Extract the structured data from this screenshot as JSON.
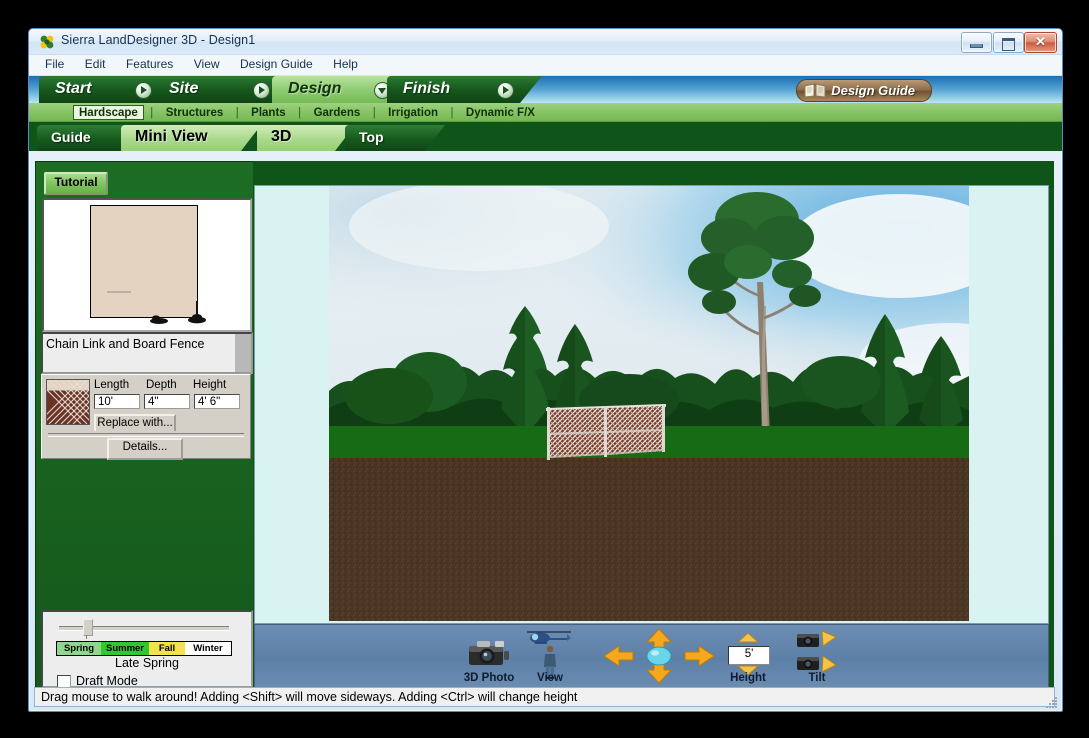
{
  "window": {
    "title": "Sierra LandDesigner 3D - Design1",
    "app_icon": "clover-icon",
    "minimize_label": "",
    "maximize_label": "",
    "close_label": "✕"
  },
  "menubar": {
    "items": [
      {
        "label": "File"
      },
      {
        "label": "Edit"
      },
      {
        "label": "Features"
      },
      {
        "label": "View"
      },
      {
        "label": "Design Guide"
      },
      {
        "label": "Help"
      }
    ]
  },
  "banner": {
    "stages": [
      {
        "label": "Start",
        "state": "dark",
        "arrow": "play"
      },
      {
        "label": "Site",
        "state": "dark",
        "arrow": "play"
      },
      {
        "label": "Design",
        "state": "light",
        "arrow": "down"
      },
      {
        "label": "Finish",
        "state": "dark",
        "arrow": "play"
      }
    ],
    "design_guide_label": "Design Guide",
    "design_guide_icon": "book-icon"
  },
  "subnav": {
    "items": [
      {
        "label": "Hardscape",
        "active": true
      },
      {
        "label": "Structures",
        "active": false
      },
      {
        "label": "Plants",
        "active": false
      },
      {
        "label": "Gardens",
        "active": false
      },
      {
        "label": "Irrigation",
        "active": false
      },
      {
        "label": "Dynamic F/X",
        "active": false
      }
    ],
    "separator": "|"
  },
  "tabs": {
    "left": [
      {
        "label": "Guide",
        "state": "dark"
      },
      {
        "label": "Mini View",
        "state": "light"
      }
    ],
    "right": [
      {
        "label": "3D",
        "state": "light"
      },
      {
        "label": "Top",
        "state": "dark"
      }
    ]
  },
  "left_panel": {
    "tutorial_label": "Tutorial",
    "miniview": {
      "lot_name": "property-lot",
      "handles": [
        "fence-handle-left",
        "fence-handle-right"
      ]
    },
    "object_list": {
      "selected": "Chain Link and Board Fence"
    },
    "properties": {
      "swatch_name": "chain-link-fence-swatch",
      "headers": [
        "Length",
        "Depth",
        "Height"
      ],
      "values": [
        "10'",
        "4\"",
        "4' 6\""
      ],
      "replace_label": "Replace with...",
      "details_label": "Details..."
    },
    "season": {
      "segments": [
        {
          "label": "Spring",
          "color": "#8fd68f"
        },
        {
          "label": "Summer",
          "color": "#2fc82f"
        },
        {
          "label": "Fall",
          "color": "#f2e34a"
        },
        {
          "label": "Winter",
          "color": "#ffffff"
        }
      ],
      "current": "Late Spring",
      "draft_mode_label": "Draft Mode",
      "draft_mode_checked": false
    }
  },
  "viewport": {
    "scene": "3d-landscape-preview",
    "backdrop": "forest-photo-backdrop",
    "object": "chain-link-fence-3d"
  },
  "control_bar": {
    "photo_label": "3D Photo",
    "photo_icon": "camera-icon",
    "view_label": "View",
    "view_icons": [
      "helicopter-icon",
      "person-icon"
    ],
    "pan_icon": "four-way-arrow-pad",
    "height_label": "Height",
    "height_value": "5'",
    "tilt_label": "Tilt",
    "tilt_icons": [
      "camera-tilt-up-icon",
      "camera-tilt-down-icon"
    ]
  },
  "status_bar": {
    "message": "Drag mouse to walk around!  Adding <Shift> will move sideways. Adding <Ctrl> will change height"
  },
  "colors": {
    "banner_blue": "#4f9ed0",
    "stage_dark_green": "#17591d",
    "stage_light_green": "#8fcc72",
    "panel_green": "#15591b",
    "grass": "#176b14",
    "dirt": "#4b3522",
    "ctrl_bar": "#5d80a8",
    "close_red": "#cc5a3c",
    "viewport_bg": "#d9f2f2"
  }
}
